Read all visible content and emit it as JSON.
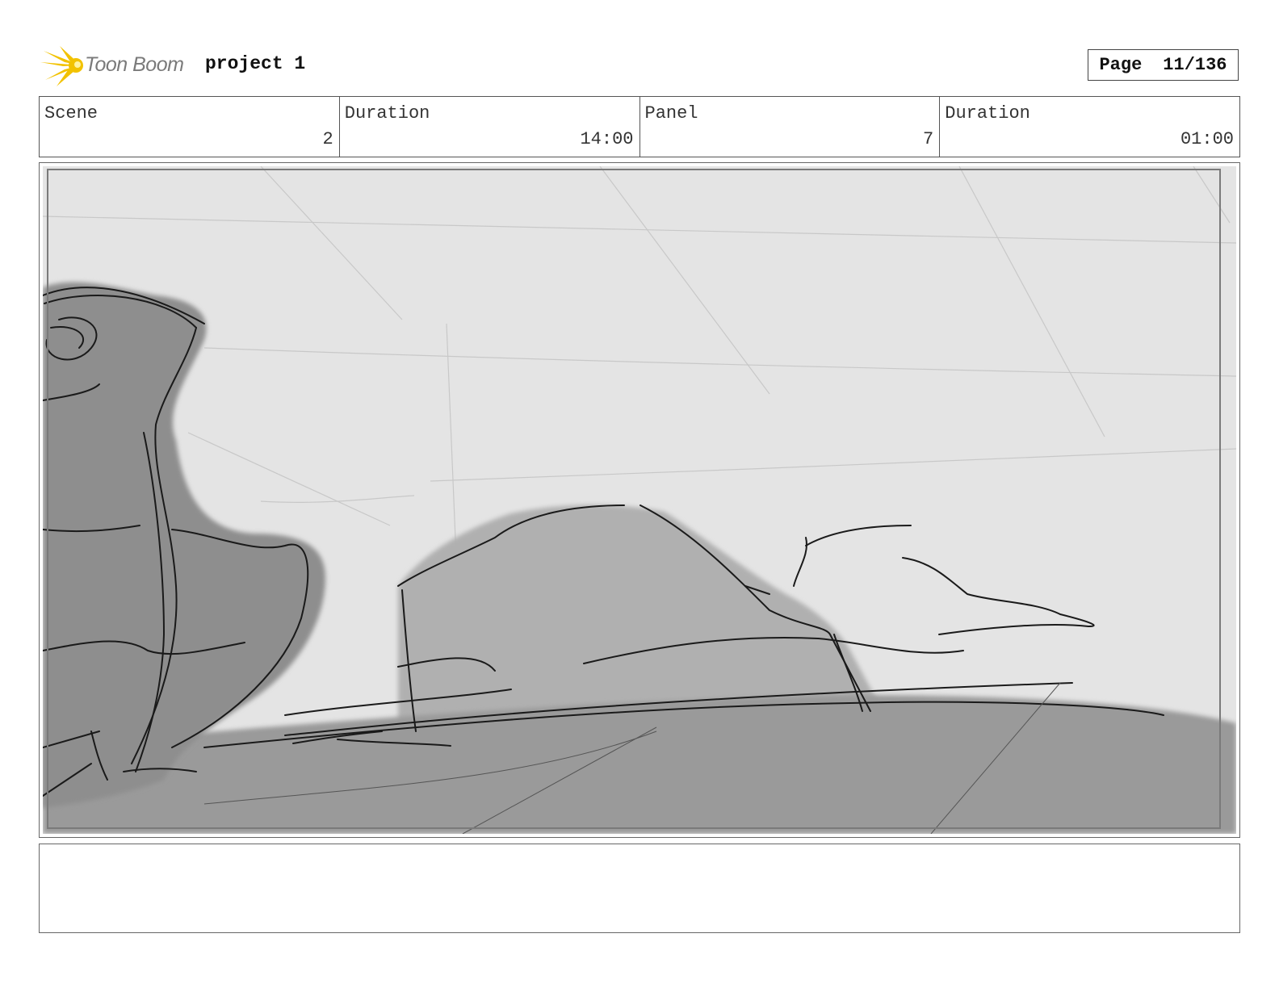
{
  "header": {
    "logo_text": "Toon Boom",
    "project_title": "project 1",
    "page_label": "Page",
    "page_value": "11/136"
  },
  "info": {
    "scene_label": "Scene",
    "scene_value": "2",
    "scene_duration_label": "Duration",
    "scene_duration_value": "14:00",
    "panel_label": "Panel",
    "panel_value": "7",
    "panel_duration_label": "Duration",
    "panel_duration_value": "01:00"
  },
  "panel": {
    "image_kind": "rough pencil sketch of rock formations on ground plane"
  },
  "notes": {
    "text": ""
  },
  "colors": {
    "logo_flare": "#f2c200",
    "sky": "#e4e4e4",
    "ground": "#9a9a9a",
    "rock_dark": "#8e8e8e",
    "rock_mid": "#b0b0b0"
  }
}
